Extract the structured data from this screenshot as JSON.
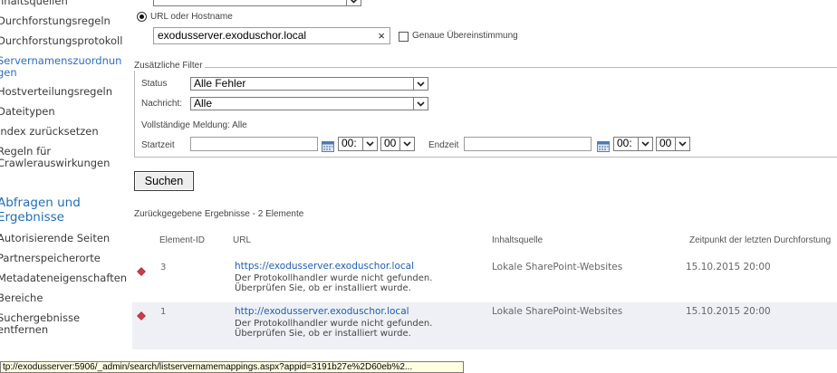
{
  "nav": {
    "items_top": [
      {
        "label": "nhaltsquellen",
        "active": false
      },
      {
        "label": "Durchforstungsregeln",
        "active": false
      },
      {
        "label": "Durchforstungsprotokoll",
        "active": false
      },
      {
        "label": "Servernamenszuordnungen",
        "label_line1": "Servernamenszuordnun",
        "label_line2": "gen",
        "active": true
      },
      {
        "label": "Hostverteilungsregeln",
        "active": false
      },
      {
        "label": "Dateitypen",
        "active": false
      },
      {
        "label": "Index zurücksetzen",
        "active": false
      },
      {
        "label": "Regeln für Crawlerauswirkungen",
        "label_line1": "Regeln für",
        "label_line2": "Crawlerauswirkungen",
        "active": false
      }
    ],
    "heading_line1": "Abfragen und",
    "heading_line2": "Ergebnisse",
    "items_bottom": [
      {
        "label": "Autorisierende Seiten"
      },
      {
        "label": "Partnerspeicherorte"
      },
      {
        "label": "Metadateneigenschaften"
      },
      {
        "label": "Bereiche"
      },
      {
        "label_line1": "Suchergebnisse",
        "label_line2": "entfernen"
      }
    ]
  },
  "form": {
    "url_option_label": "URL oder Hostname",
    "url_value": "exodusserver.exoduschor.local",
    "clear_glyph": "×",
    "exact_match_label": "Genaue Übereinstimmung",
    "filters_legend": "Zusätzliche Filter",
    "status_label": "Status",
    "status_value": "Alle Fehler",
    "message_label": "Nachricht:",
    "message_value": "Alle",
    "full_message_text": "Vollständige Meldung: Alle",
    "start_label": "Startzeit",
    "end_label": "Endzeit",
    "start_hour": "00:",
    "start_minute": "00",
    "end_hour": "00:",
    "end_minute": "00",
    "search_button": "Suchen"
  },
  "results": {
    "summary": "Zurückgegebene Ergebnisse - 2 Elemente",
    "columns": [
      "Element-ID",
      "URL",
      "Inhaltsquelle",
      "Zeitpunkt der letzten Durchforstung"
    ],
    "rows": [
      {
        "id": "3",
        "url": "https://exodusserver.exoduschor.local",
        "message_line1": "Der Protokollhandler wurde nicht gefunden.",
        "message_line2": "Überprüfen Sie, ob er installiert wurde.",
        "source": "Lokale SharePoint-Websites",
        "time": "15.10.2015 20:00"
      },
      {
        "id": "1",
        "url": "http://exodusserver.exoduschor.local",
        "message_line1": "Der Protokollhandler wurde nicht gefunden.",
        "message_line2": "Überprüfen Sie, ob er installiert wurde.",
        "source": "Lokale SharePoint-Websites",
        "time": "15.10.2015 20:00"
      }
    ]
  },
  "status_bar": "tp://exodusserver:5906/_admin/search/listservernamemappings.aspx?appid=3191b27e%2D60eb%2...",
  "colors": {
    "link": "#1d5fb2",
    "nav_heading": "#1f6fb5",
    "error_icon": "#d03a47",
    "alt_row": "#eef0f5",
    "tooltip_bg": "#ffffe1"
  }
}
